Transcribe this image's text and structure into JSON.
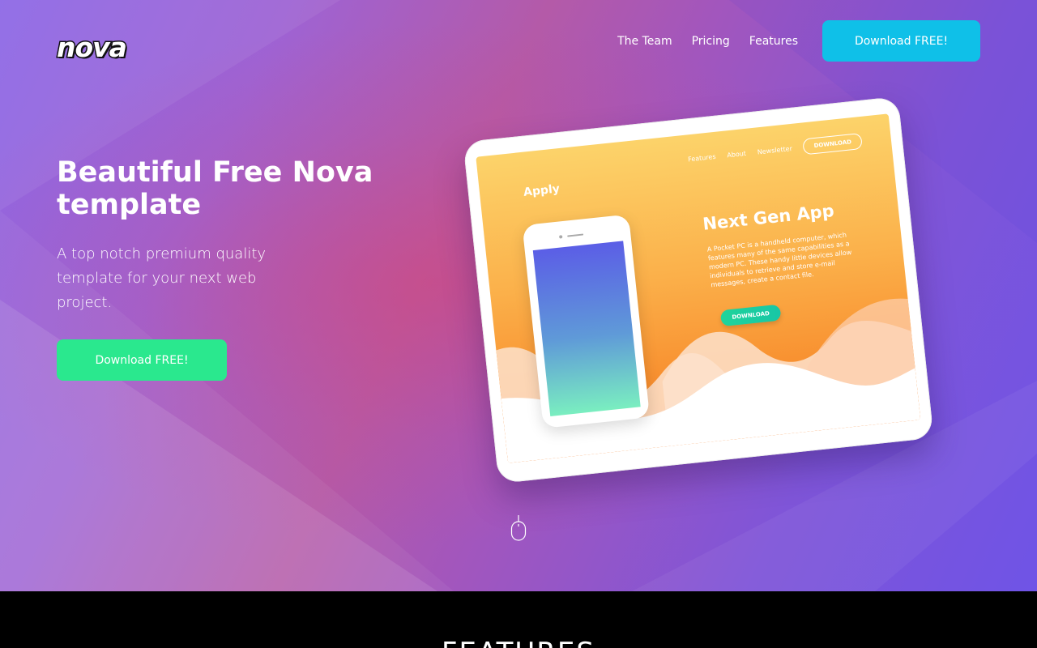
{
  "brand": {
    "logo_text": "nova"
  },
  "nav": {
    "items": [
      {
        "label": "The Team"
      },
      {
        "label": "Pricing"
      },
      {
        "label": "Features"
      }
    ],
    "cta_label": "Download FREE!"
  },
  "hero": {
    "title": "Beautiful Free Nova template",
    "subtitle": "A top notch premium quality template for your next web project.",
    "cta_label": "Download FREE!"
  },
  "mockup": {
    "brand": "Apply",
    "nav": [
      "Features",
      "About",
      "Newsletter"
    ],
    "nav_button": "DOWNLOAD",
    "title": "Next Gen App",
    "description": "A Pocket PC is a handheld computer, which features many of the same capabilities as a modern PC. These handy little devices allow individuals to retrieve and store e-mail messages, create a contact file.",
    "button": "DOWNLOAD"
  },
  "features": {
    "heading": "FEATURES"
  },
  "colors": {
    "nav_cta": "#0fc0e8",
    "hero_cta": "#2ae88e",
    "mockup_orange": "#f88e2e",
    "mockup_button": "#1fd49a"
  },
  "icons": {
    "scroll": "mouse-icon"
  }
}
